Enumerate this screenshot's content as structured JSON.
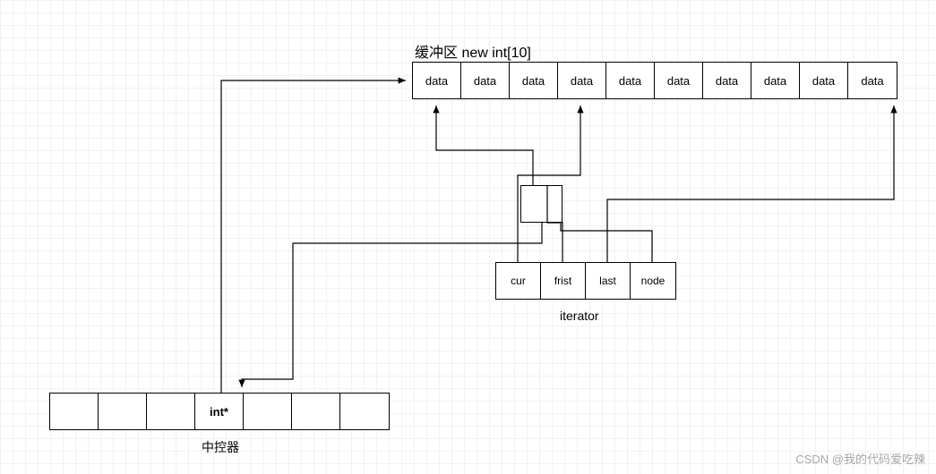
{
  "buffer": {
    "title": "缓冲区 new int[10]",
    "cells": [
      "data",
      "data",
      "data",
      "data",
      "data",
      "data",
      "data",
      "data",
      "data",
      "data"
    ]
  },
  "iterator": {
    "label": "iterator",
    "cells": [
      "cur",
      "frist",
      "last",
      "node"
    ]
  },
  "controller": {
    "label": "中控器",
    "pointer_label": "int*"
  },
  "watermark": "CSDN @我的代码爱吃辣"
}
